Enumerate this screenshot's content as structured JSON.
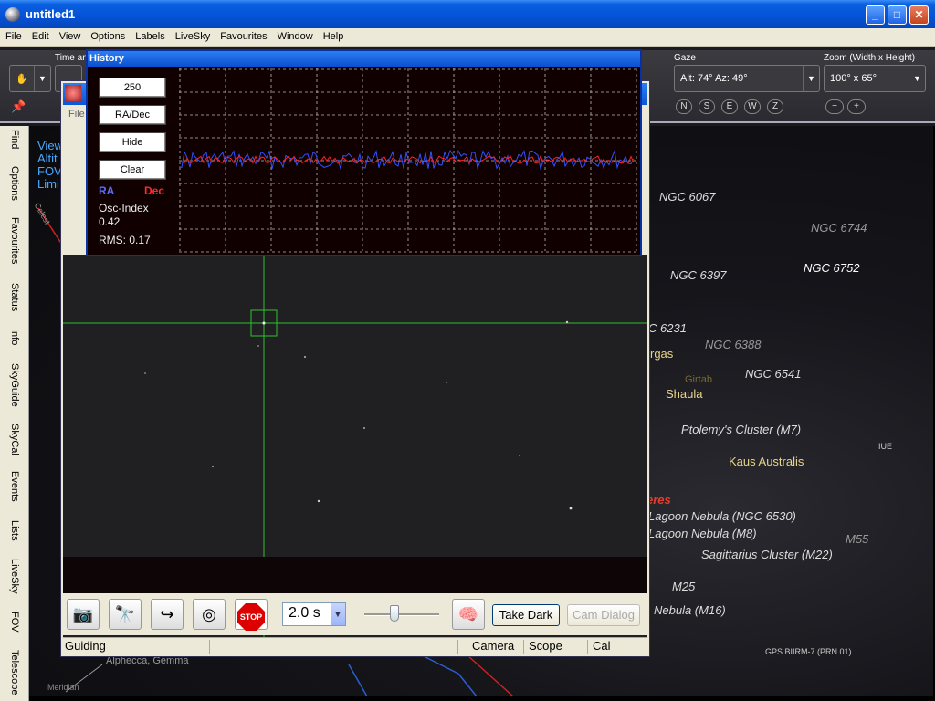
{
  "window": {
    "title": "untitled1",
    "min": "_",
    "max": "□",
    "close": "✕"
  },
  "menu": [
    "File",
    "Edit",
    "View",
    "Options",
    "Labels",
    "LiveSky",
    "Favourites",
    "Window",
    "Help"
  ],
  "toolbar": {
    "time_label": "Time an",
    "gaze_label": "Gaze",
    "gaze_value": "Alt: 74° Az: 49°",
    "zoom_label": "Zoom (Width x Height)",
    "zoom_value": "100° x 65°",
    "compass": [
      "N",
      "S",
      "E",
      "W",
      "Z"
    ],
    "zoom_minus": "−",
    "zoom_plus": "+"
  },
  "sidetabs": [
    "Find",
    "Options",
    "Favourites",
    "Status",
    "Info",
    "SkyGuide",
    "SkyCal",
    "Events",
    "Lists",
    "LiveSky",
    "FOV",
    "Telescope"
  ],
  "sky_overlay": [
    "View",
    "Altit",
    "FOV",
    "Limi"
  ],
  "sky_labels": [
    "NGC 6067",
    "NGC 6744",
    "NGC 6397",
    "NGC 6752",
    "C 6231",
    "NGC 6388",
    "rgas",
    "NGC 6541",
    "Girtab",
    "Shaula",
    "Ptolemy's Cluster (M7)",
    "IUE",
    "Kaus Australis",
    "eres",
    "Lagoon Nebula (NGC 6530)",
    "Lagoon Nebula (M8)",
    "M55",
    "Sagittarius Cluster (M22)",
    "M25",
    "Nebula (M16)",
    "GPS BIIRM-7 (PRN 01)",
    "Alphecca, Gemma",
    "Celest",
    "Meridian"
  ],
  "phd": {
    "menu_file": "File",
    "exposure": "2.0 s",
    "take_dark": "Take Dark",
    "cam_dialog": "Cam Dialog",
    "stop_label": "STOP",
    "status": {
      "guiding": "Guiding",
      "camera": "Camera",
      "scope": "Scope",
      "cal": "Cal"
    }
  },
  "history": {
    "title": "History",
    "btn_length": "250",
    "btn_mode": "RA/Dec",
    "btn_hide": "Hide",
    "btn_clear": "Clear",
    "ra_label": "RA",
    "dec_label": "Dec",
    "osc_label": "Osc-Index",
    "osc_value": "0.42",
    "rms_label": "RMS: 0.17",
    "colors": {
      "ra": "#3050ff",
      "dec": "#ff2020",
      "grid": "#bbbbbb"
    }
  }
}
